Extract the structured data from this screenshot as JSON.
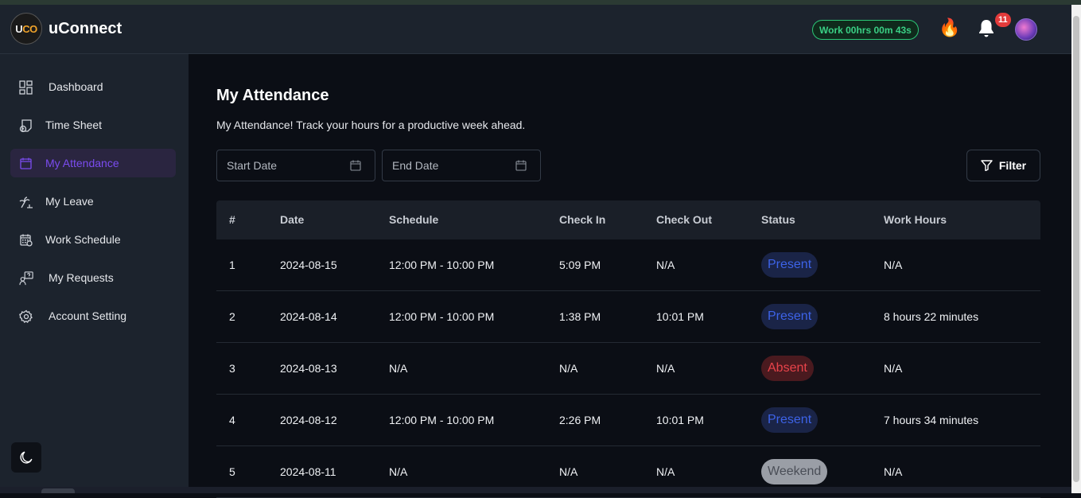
{
  "app": {
    "logo_text_a": "U",
    "logo_text_b": "CO",
    "title": "uConnect"
  },
  "header": {
    "work_timer": "Work 00hrs 00m 43s",
    "notification_count": "11",
    "fire_glyph": "🔥"
  },
  "sidebar": {
    "items": [
      {
        "label": "Dashboard",
        "icon": "dashboard-icon"
      },
      {
        "label": "Time Sheet",
        "icon": "timesheet-icon"
      },
      {
        "label": "My Attendance",
        "icon": "calendar-icon",
        "active": true
      },
      {
        "label": "My Leave",
        "icon": "leave-icon"
      },
      {
        "label": "Work Schedule",
        "icon": "schedule-icon"
      },
      {
        "label": "My Requests",
        "icon": "requests-icon"
      },
      {
        "label": "Account Setting",
        "icon": "gear-icon"
      }
    ]
  },
  "main": {
    "title": "My Attendance",
    "subtitle": "My Attendance! Track your hours for a productive week ahead.",
    "start_placeholder": "Start Date",
    "end_placeholder": "End Date",
    "filter_label": "Filter"
  },
  "table": {
    "headers": [
      "#",
      "Date",
      "Schedule",
      "Check In",
      "Check Out",
      "Status",
      "Work Hours"
    ],
    "rows": [
      {
        "n": "1",
        "date": "2024-08-15",
        "schedule": "12:00 PM - 10:00 PM",
        "check_in": "5:09 PM",
        "check_out": "N/A",
        "status": "Present",
        "hours": "N/A"
      },
      {
        "n": "2",
        "date": "2024-08-14",
        "schedule": "12:00 PM - 10:00 PM",
        "check_in": "1:38 PM",
        "check_out": "10:01 PM",
        "status": "Present",
        "hours": "8 hours 22 minutes"
      },
      {
        "n": "3",
        "date": "2024-08-13",
        "schedule": "N/A",
        "check_in": "N/A",
        "check_out": "N/A",
        "status": "Absent",
        "hours": "N/A"
      },
      {
        "n": "4",
        "date": "2024-08-12",
        "schedule": "12:00 PM - 10:00 PM",
        "check_in": "2:26 PM",
        "check_out": "10:01 PM",
        "status": "Present",
        "hours": "7 hours 34 minutes"
      },
      {
        "n": "5",
        "date": "2024-08-11",
        "schedule": "N/A",
        "check_in": "N/A",
        "check_out": "N/A",
        "status": "Weekend",
        "hours": "N/A"
      }
    ]
  },
  "colors": {
    "accent": "#7b4cf0",
    "present_bg": "#1a2447",
    "present_fg": "#3d63e8",
    "absent_bg": "#4a1a1f",
    "absent_fg": "#e8434a",
    "weekend_bg": "#9a9ea6",
    "weekend_fg": "#4a4e57",
    "timer": "#3ad085"
  }
}
